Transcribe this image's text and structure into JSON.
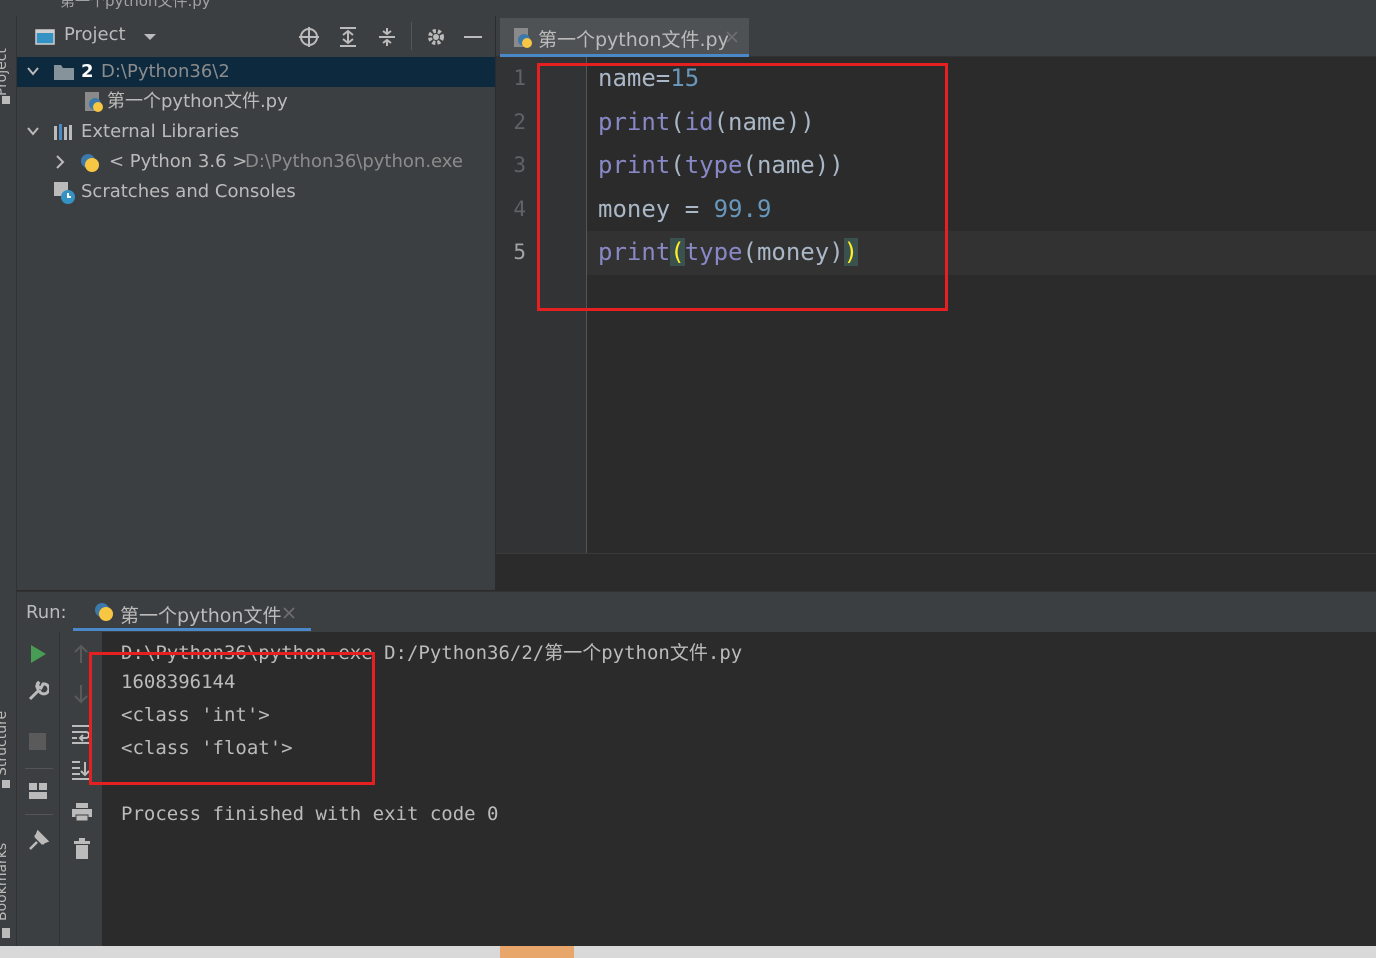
{
  "window": {
    "breadcrumb": "第一个python文件.py"
  },
  "left_stripe": {
    "project_label": "Project",
    "structure_label": "Structure",
    "bookmarks_label": "Bookmarks"
  },
  "project_panel": {
    "title": "Project",
    "tree": [
      {
        "bold": "2",
        "label": "D:\\Python36\\2",
        "icon": "folder-icon",
        "expanded": true,
        "selected": true
      },
      {
        "label": "第一个python文件.py",
        "icon": "python-file-icon"
      },
      {
        "label": "External Libraries",
        "icon": "library-icon",
        "expanded": true
      },
      {
        "label": "< Python 3.6 >",
        "detail": "D:\\Python36\\python.exe",
        "icon": "python-sdk-icon",
        "expanded": false
      },
      {
        "label": "Scratches and Consoles",
        "icon": "scratches-icon"
      }
    ]
  },
  "editor": {
    "tab_label": "第一个python文件.py",
    "line_numbers": [
      "1",
      "2",
      "3",
      "4",
      "5"
    ],
    "code_lines": [
      {
        "tokens": [
          [
            "plain",
            "name"
          ],
          [
            "plain",
            "="
          ],
          [
            "num",
            "15"
          ]
        ]
      },
      {
        "tokens": [
          [
            "builtin",
            "print"
          ],
          [
            "plain",
            "("
          ],
          [
            "builtin",
            "id"
          ],
          [
            "plain",
            "(name))"
          ]
        ]
      },
      {
        "tokens": [
          [
            "builtin",
            "print"
          ],
          [
            "plain",
            "("
          ],
          [
            "builtin",
            "type"
          ],
          [
            "plain",
            "(name))"
          ]
        ]
      },
      {
        "tokens": [
          [
            "plain",
            "money = "
          ],
          [
            "num",
            "99.9"
          ]
        ]
      },
      {
        "tokens": [
          [
            "builtin",
            "print"
          ],
          [
            "hl",
            "("
          ],
          [
            "builtin",
            "type"
          ],
          [
            "plain",
            "(money)"
          ],
          [
            "hl",
            ")"
          ]
        ]
      }
    ]
  },
  "run": {
    "label": "Run:",
    "tab_label": "第一个python文件",
    "output": [
      "D:\\Python36\\python.exe D:/Python36/2/第一个python文件.py",
      "1608396144",
      "<class 'int'>",
      "<class 'float'>",
      "",
      "Process finished with exit code 0"
    ]
  },
  "colors": {
    "highlight_box": "#e62020",
    "accent": "#4a88c7",
    "builtin": "#8888c6",
    "number": "#6897bb"
  }
}
